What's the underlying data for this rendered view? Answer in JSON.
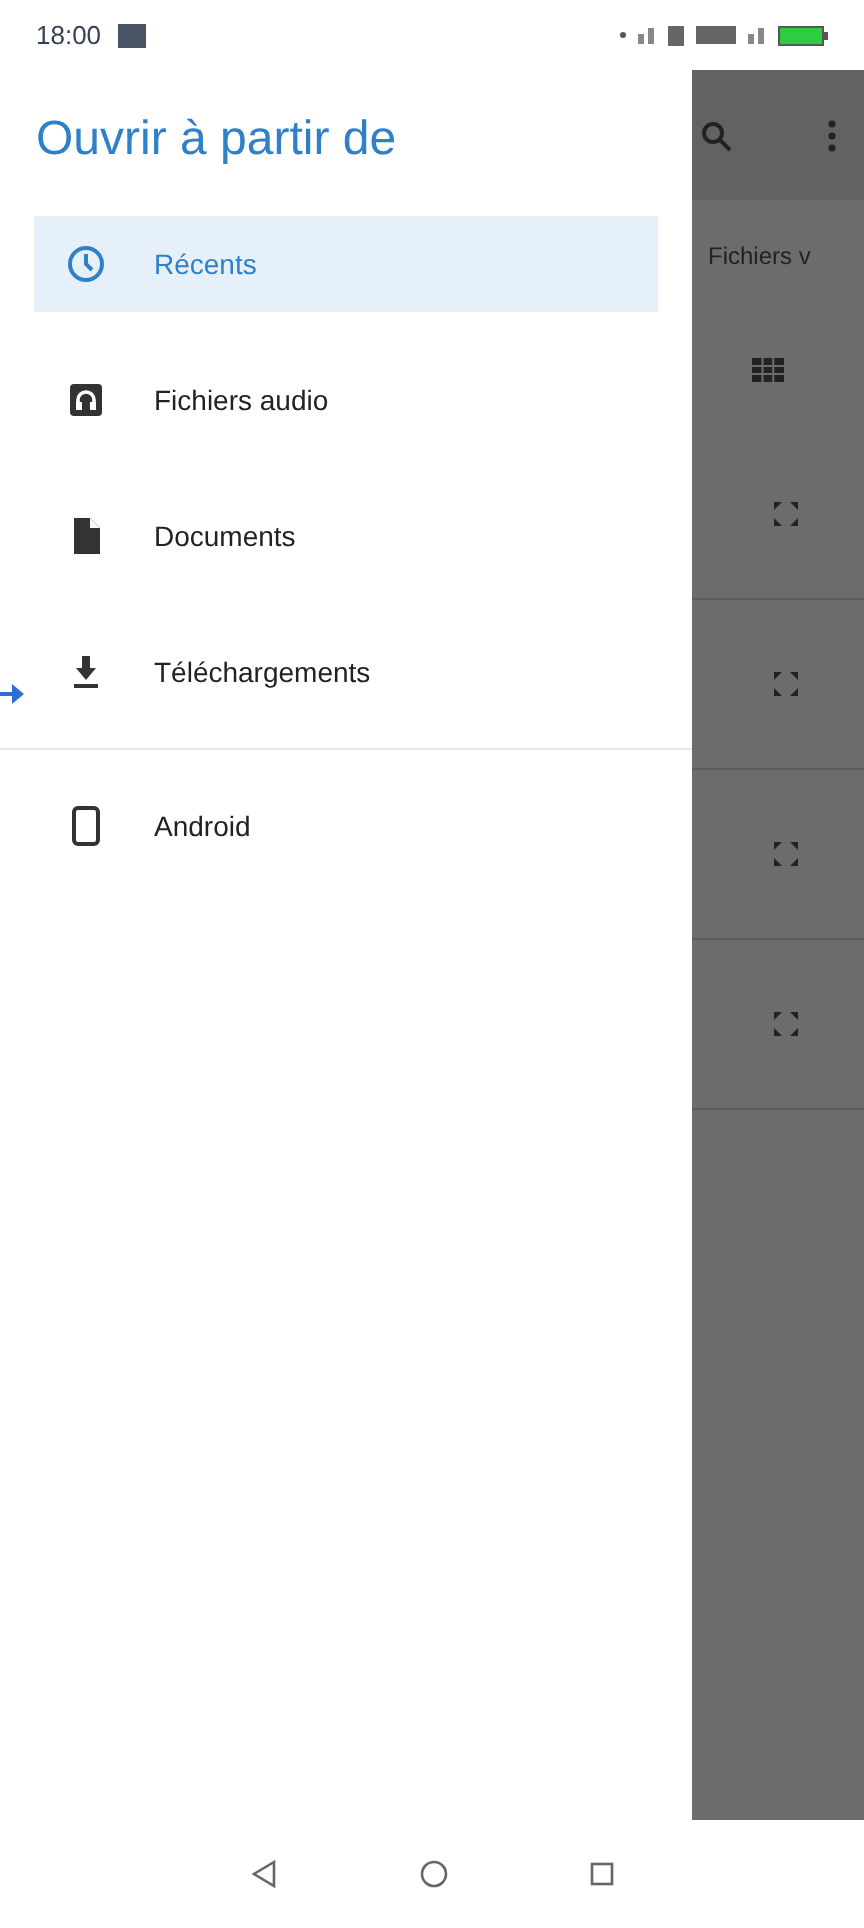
{
  "status_bar": {
    "time": "18:00"
  },
  "drawer": {
    "title": "Ouvrir à partir de",
    "sections": [
      {
        "items": [
          {
            "label": "Récents",
            "kind": "clock",
            "selected": true
          },
          {
            "label": "Fichiers audio",
            "kind": "audio",
            "selected": false
          },
          {
            "label": "Documents",
            "kind": "document",
            "selected": false
          },
          {
            "label": "Téléchargements",
            "kind": "download",
            "selected": false
          }
        ]
      },
      {
        "items": [
          {
            "label": "Android",
            "kind": "phone",
            "selected": false
          }
        ]
      }
    ]
  },
  "background": {
    "breadcrumb": "Fichiers v"
  }
}
